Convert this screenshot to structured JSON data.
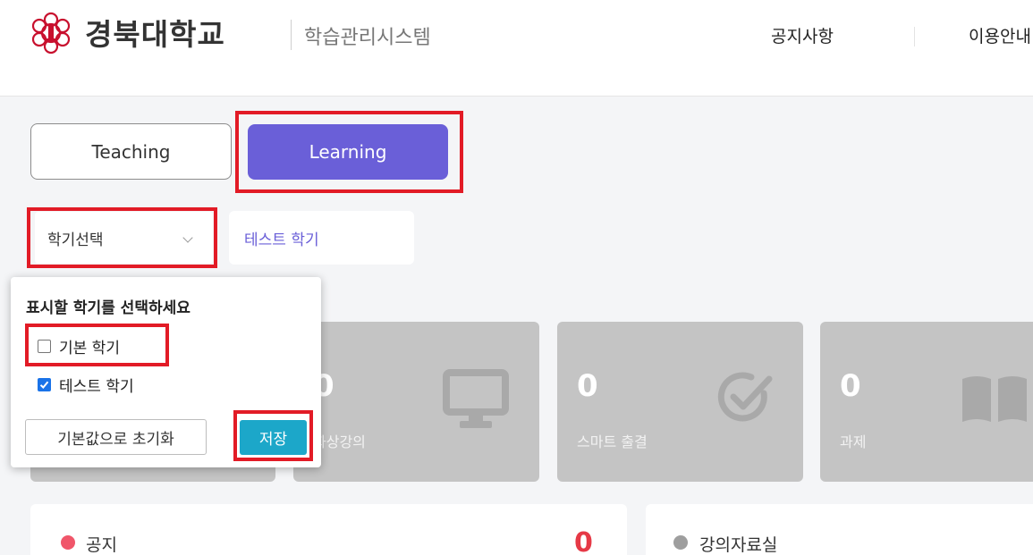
{
  "header": {
    "brand_title": "경북대학교",
    "brand_subtitle": "학습관리시스템",
    "nav": {
      "notice": "공지사항",
      "guide": "이용안내"
    }
  },
  "mode_tabs": {
    "teaching": "Teaching",
    "learning": "Learning",
    "active": "Learning"
  },
  "semester": {
    "select_label": "학기선택",
    "selected_chip": "테스트 학기"
  },
  "stat_cards": [
    {
      "value": "0",
      "label": "화상강의",
      "icon": "monitor-icon"
    },
    {
      "value": "0",
      "label": "스마트 출결",
      "icon": "check-circle-icon"
    },
    {
      "value": "0",
      "label": "과제",
      "icon": "book-icon"
    }
  ],
  "panels": [
    {
      "title": "공지",
      "count": "0",
      "dot_color": "#f0566a"
    },
    {
      "title": "강의자료실",
      "dot_color": "#9e9e9e"
    }
  ],
  "popover": {
    "title": "표시할 학기를 선택하세요",
    "options": [
      {
        "label": "기본 학기",
        "checked": false
      },
      {
        "label": "테스트 학기",
        "checked": true
      }
    ],
    "reset_label": "기본값으로 초기화",
    "save_label": "저장"
  },
  "colors": {
    "accent": "#6a5fd8",
    "save": "#1ca7c9",
    "highlight": "#e21b26",
    "checkbox": "#1a73e8"
  }
}
